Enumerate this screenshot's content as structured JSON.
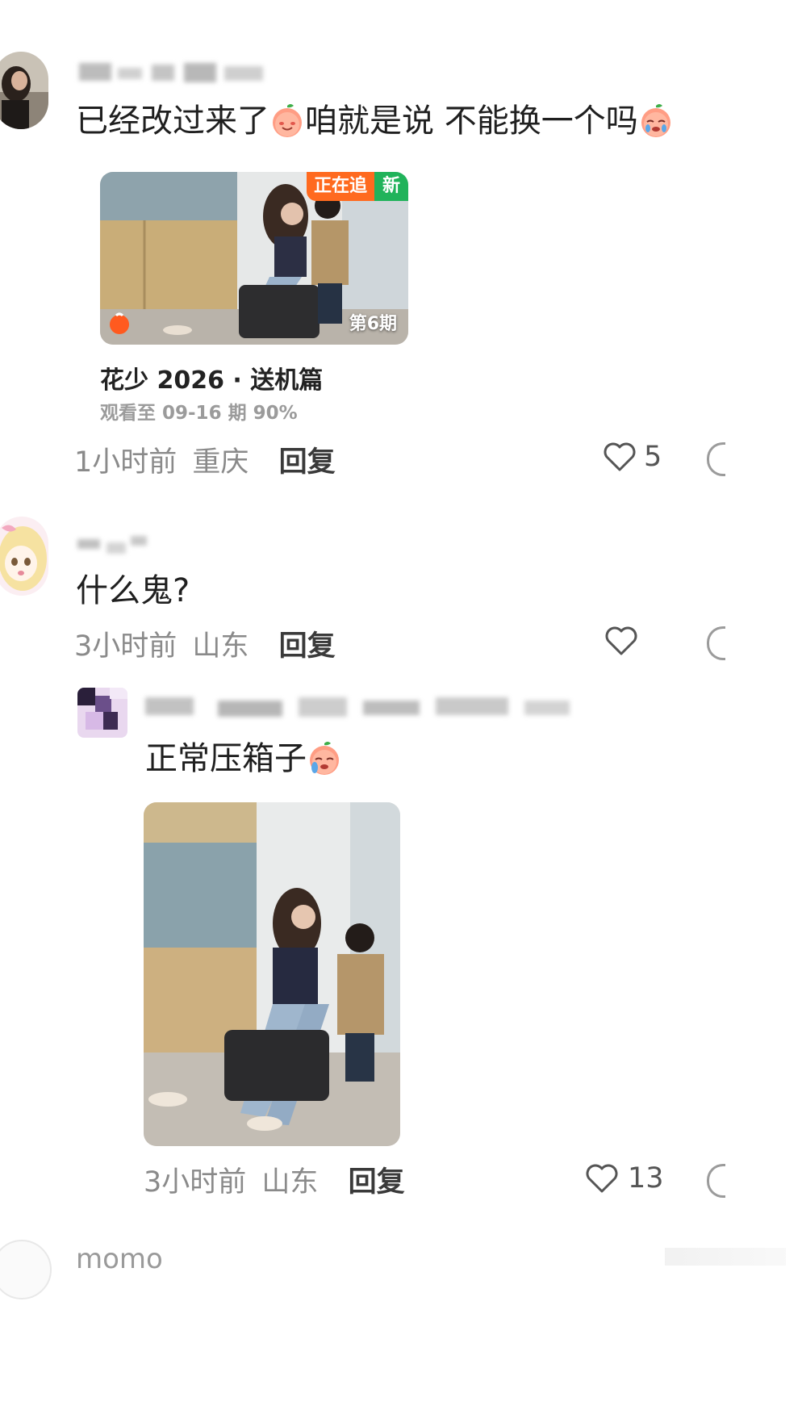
{
  "comments": [
    {
      "text_part1": "已经改过来了",
      "text_part2": "咱就是说 不能换一个吗",
      "card": {
        "badge_following": "正在追",
        "badge_new": "新",
        "episode_label": "第6期",
        "title": "花少 2026 · 送机篇",
        "progress": "观看至 09-16 期 90%"
      },
      "time": "1小时前",
      "location": "重庆",
      "reply_label": "回复",
      "likes": "5"
    },
    {
      "text": "什么鬼?",
      "time": "3小时前",
      "location": "山东",
      "reply_label": "回复"
    }
  ],
  "reply": {
    "text": "正常压箱子",
    "time": "3小时前",
    "location": "山东",
    "reply_label": "回复",
    "likes": "13"
  },
  "next_comment": {
    "username": "momo"
  },
  "icons": [
    "heart-icon",
    "comment-icon",
    "smiling-peach-emoji",
    "crying-peach-emoji",
    "orange-logo-icon"
  ],
  "colors": {
    "badge_orange": "#ff6a1f",
    "badge_green": "#20b35a",
    "meta_gray": "#8a8a8a"
  }
}
